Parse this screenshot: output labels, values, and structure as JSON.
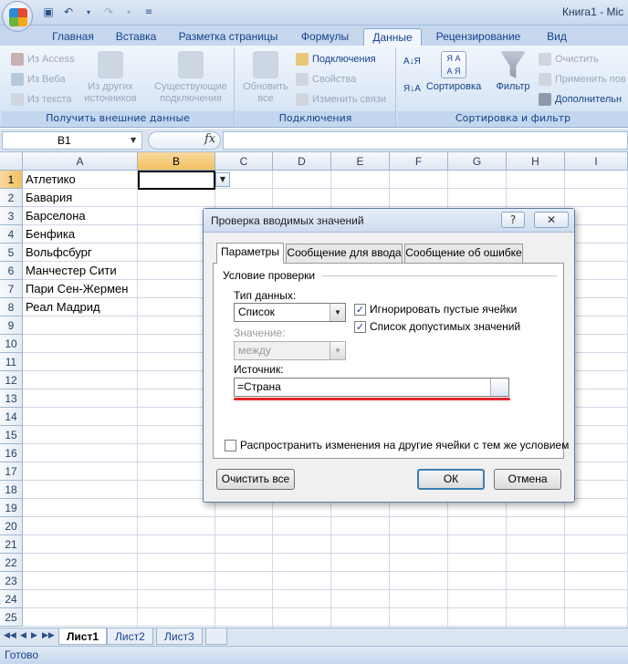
{
  "app": {
    "doc_title": "Книга1 - Mic"
  },
  "ribbon": {
    "tabs": [
      "Главная",
      "Вставка",
      "Разметка страницы",
      "Формулы",
      "Данные",
      "Рецензирование",
      "Вид"
    ],
    "active_tab": "Данные",
    "groups": {
      "external": {
        "label": "Получить внешние данные",
        "from_access": "Из Access",
        "from_web": "Из Веба",
        "from_text": "Из текста",
        "other_sources": [
          "Из других",
          "источников"
        ],
        "existing": [
          "Существующие",
          "подключения"
        ]
      },
      "connections": {
        "label": "Подключения",
        "refresh": [
          "Обновить",
          "все"
        ],
        "connections": "Подключения",
        "properties": "Свойства",
        "edit_links": "Изменить связи"
      },
      "sort": {
        "label": "Сортировка и фильтр",
        "sort": "Сортировка",
        "filter": "Фильтр",
        "clear": "Очистить",
        "reapply": "Применить пов",
        "advanced": "Дополнительн"
      }
    }
  },
  "formula_bar": {
    "name_box": "B1",
    "fx": "fx",
    "value": ""
  },
  "grid": {
    "columns": [
      "A",
      "B",
      "C",
      "D",
      "E",
      "F",
      "G",
      "H",
      "I"
    ],
    "selected_column": "B",
    "selected_row": 1,
    "rows": [
      "1",
      "2",
      "3",
      "4",
      "5",
      "6",
      "7",
      "8",
      "9",
      "10",
      "11",
      "12",
      "13",
      "14",
      "15",
      "16",
      "17",
      "18",
      "19",
      "20",
      "21",
      "22",
      "23",
      "24",
      "25"
    ],
    "column_a": [
      "Атлетико",
      "Бавария",
      "Барселона",
      "Бенфика",
      "Вольфсбург",
      "Манчестер Сити",
      "Пари Сен-Жермен",
      "Реал Мадрид"
    ]
  },
  "sheets": {
    "tabs": [
      "Лист1",
      "Лист2",
      "Лист3"
    ],
    "active": "Лист1"
  },
  "status": {
    "text": "Готово"
  },
  "dialog": {
    "title": "Проверка вводимых значений",
    "help": "?",
    "close": "✕",
    "tabs": [
      "Параметры",
      "Сообщение для ввода",
      "Сообщение об ошибке"
    ],
    "active_tab": "Параметры",
    "section": "Условие проверки",
    "data_type_label": "Тип данных:",
    "data_type_value": "Список",
    "ignore_blank": {
      "label": "Игнорировать пустые ячейки",
      "checked": true
    },
    "in_cell_dropdown": {
      "label": "Список допустимых значений",
      "checked": true
    },
    "value_label": "Значение:",
    "value_value": "между",
    "source_label": "Источник:",
    "source_value": "=Страна",
    "apply_all": {
      "label": "Распространить изменения на другие ячейки с тем же условием",
      "checked": false
    },
    "clear_all": "Очистить все",
    "ok": "ОК",
    "cancel": "Отмена"
  },
  "colors": {
    "accent_red": "#e3252a",
    "ribbon_blue": "#15428b",
    "selection": "#f1c15f"
  }
}
